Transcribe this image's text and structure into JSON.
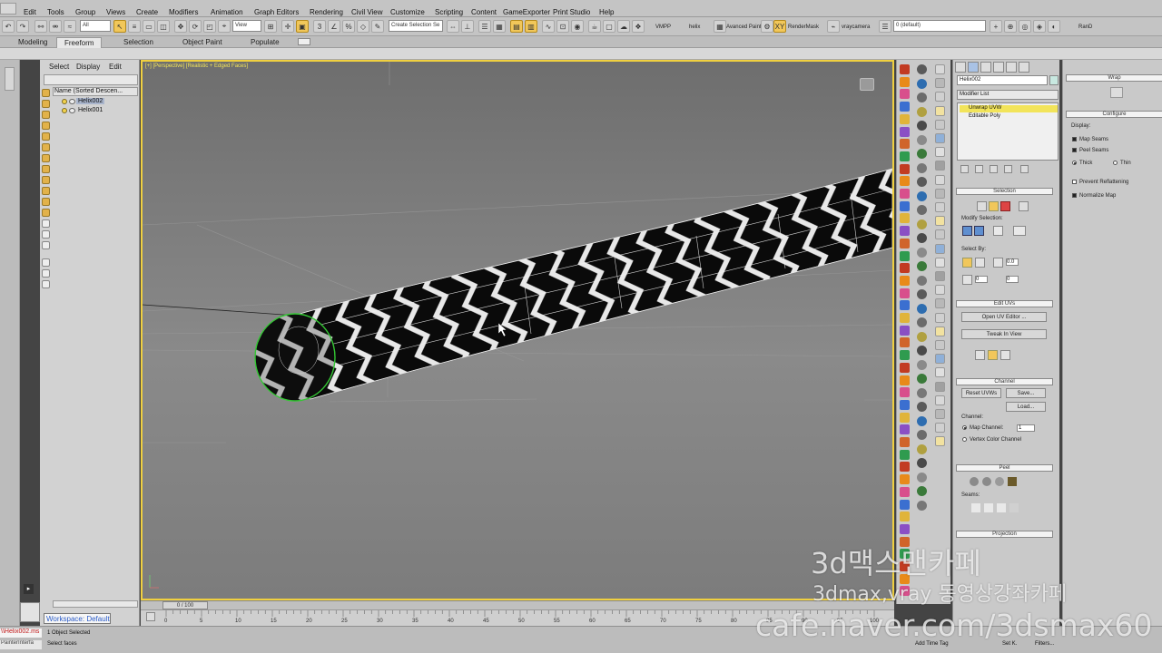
{
  "menus": [
    "Edit",
    "Tools",
    "Group",
    "Views",
    "Create",
    "Modifiers",
    "Animation",
    "Graph Editors",
    "Rendering",
    "Civil View",
    "Customize",
    "Scripting",
    "Content",
    "GameExporter",
    "Print Studio",
    "Help"
  ],
  "toolbar": {
    "filter_all": "All",
    "view": "View",
    "create_selection": "Create Selection Se",
    "vmpp": "VMPP",
    "helix": "helix",
    "advanced_paint": "Avanced Paint",
    "render_mask": "RenderMask",
    "vraycamera": "vraycamera",
    "layer": "0 (default)",
    "ran_d": "RanD"
  },
  "ribbon_tabs": [
    "Modeling",
    "Freeform",
    "Selection",
    "Object Paint",
    "Populate"
  ],
  "explorer": {
    "tabs": [
      "Select",
      "Display",
      "Edit"
    ],
    "column_header": "Name (Sorted Descen...",
    "rows": [
      "Helix002",
      "Helix001"
    ],
    "workspace": "Workspace: Default"
  },
  "viewport": {
    "label": "[+] [Perspective] [Realistic + Edged Faces]"
  },
  "timeline": {
    "slider": "0 / 100",
    "ticks": [
      "0",
      "5",
      "10",
      "15",
      "20",
      "25",
      "30",
      "35",
      "40",
      "45",
      "50",
      "55",
      "60",
      "65",
      "70",
      "75",
      "80",
      "85",
      "90",
      "95",
      "100"
    ]
  },
  "status": {
    "file": "\\\\Helix002.ms",
    "painter": "PainterInterfa",
    "objects_selected": "1 Object Selected",
    "select_faces": "Select faces",
    "add_time_tag": "Add Time Tag",
    "set_k": "Set K.",
    "filters": "Filters..."
  },
  "cmd_panel": {
    "object_name": "Helix002",
    "modifier_list": "Modifier List",
    "stack": [
      "Unwrap UVW",
      "Editable Poly"
    ],
    "selection": {
      "title": "Selection",
      "modify_selection": "Modify Selection:",
      "select_by": "Select By:",
      "val1": "0.0",
      "val2": "0"
    },
    "edit_uvs": {
      "title": "Edit UVs",
      "open_uv_editor": "Open UV Editor ...",
      "tweak_in_view": "Tweak In View"
    },
    "channel": {
      "title": "Channel",
      "reset_uvws": "Reset UVWs",
      "save": "Save...",
      "load": "Load...",
      "group": "Channel:",
      "map_channel": "Map Channel:",
      "map_channel_value": "1",
      "vertex_color_channel": "Vertex Color Channel"
    },
    "peel": {
      "title": "Peel",
      "seams": "Seams:"
    },
    "projection": {
      "title": "Projection"
    }
  },
  "right_panel": {
    "wrap": "Wrap",
    "configure": "Configure",
    "display": "Display:",
    "map_seams": "Map Seams",
    "peel_seams": "Peel Seams",
    "thick": "Thick",
    "thin": "Thin",
    "prevent_reflattening": "Prevent Reflattening",
    "normalize_map": "Normalize Map"
  },
  "watermark": {
    "line1": "3d맥스맨카페",
    "line2": "3dmax,vray 동영상강좌카페",
    "line3": "cafe.naver.com/3dsmax60"
  },
  "colors": {
    "ui_gray": "#c4c4c4",
    "viewport_border": "#f0d040",
    "selected_modifier": "#f2e45a",
    "highlight_button": "#f1c75a",
    "edge_selection": "#33c733"
  }
}
